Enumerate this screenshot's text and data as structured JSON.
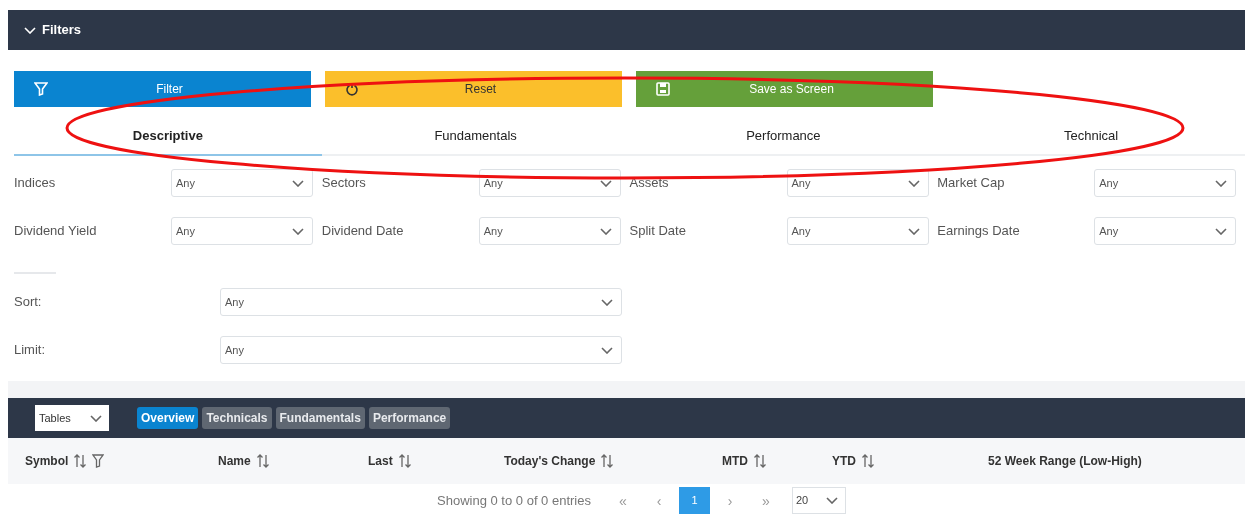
{
  "filters_panel": {
    "title": "Filters",
    "expanded": true
  },
  "actions": [
    {
      "kind": "filter",
      "label": "Filter"
    },
    {
      "kind": "reset",
      "label": "Reset"
    },
    {
      "kind": "save",
      "label": "Save as Screen"
    }
  ],
  "tabs": [
    {
      "label": "Descriptive",
      "selected": true
    },
    {
      "label": "Fundamentals",
      "selected": false
    },
    {
      "label": "Performance",
      "selected": false
    },
    {
      "label": "Technical",
      "selected": false
    }
  ],
  "filters": [
    {
      "label": "Indices",
      "value": "Any"
    },
    {
      "label": "Sectors",
      "value": "Any"
    },
    {
      "label": "Assets",
      "value": "Any"
    },
    {
      "label": "Market Cap",
      "value": "Any"
    },
    {
      "label": "Dividend Yield",
      "value": "Any"
    },
    {
      "label": "Dividend Date",
      "value": "Any"
    },
    {
      "label": "Split Date",
      "value": "Any"
    },
    {
      "label": "Earnings Date",
      "value": "Any"
    }
  ],
  "sort": {
    "label": "Sort:",
    "value": "Any"
  },
  "limit": {
    "label": "Limit:",
    "value": "Any"
  },
  "table_toolbar": {
    "tables_select": "Tables",
    "views": [
      {
        "label": "Overview",
        "selected": true
      },
      {
        "label": "Technicals",
        "selected": false
      },
      {
        "label": "Fundamentals",
        "selected": false
      },
      {
        "label": "Performance",
        "selected": false
      }
    ]
  },
  "table": {
    "columns": [
      {
        "label": "Symbol",
        "sortable": true,
        "filterable": true
      },
      {
        "label": "Name",
        "sortable": true,
        "filterable": false
      },
      {
        "label": "Last",
        "sortable": true,
        "filterable": false
      },
      {
        "label": "Today's Change",
        "sortable": true,
        "filterable": false
      },
      {
        "label": "MTD",
        "sortable": true,
        "filterable": false
      },
      {
        "label": "YTD",
        "sortable": true,
        "filterable": false
      },
      {
        "label": "52 Week Range (Low-High)",
        "sortable": false,
        "filterable": false
      }
    ]
  },
  "pagination": {
    "summary": "Showing 0 to 0 of 0 entries",
    "first": "«",
    "prev": "‹",
    "pages": [
      {
        "label": "1",
        "selected": true
      }
    ],
    "next": "›",
    "last": "»",
    "page_size": "20"
  }
}
